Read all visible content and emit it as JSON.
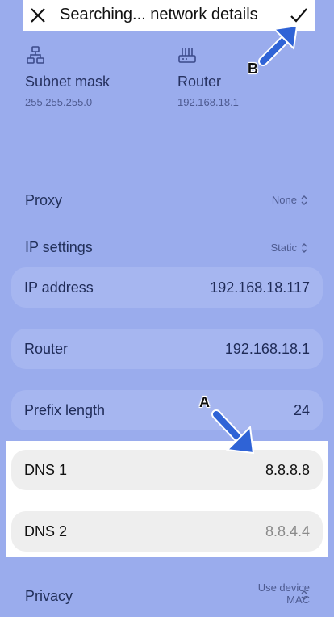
{
  "header": {
    "title": "Searching... network details",
    "close_icon": "close-icon",
    "confirm_icon": "check-icon"
  },
  "info": {
    "subnet": {
      "label": "Subnet mask",
      "value": "255.255.255.0",
      "icon": "network-topology-icon"
    },
    "router": {
      "label": "Router",
      "value": "192.168.18.1",
      "icon": "router-icon"
    }
  },
  "proxy": {
    "label": "Proxy",
    "value": "None"
  },
  "ip_settings": {
    "label": "IP settings",
    "value": "Static"
  },
  "fields": {
    "ip_address": {
      "label": "IP address",
      "value": "192.168.18.117"
    },
    "router": {
      "label": "Router",
      "value": "192.168.18.1"
    },
    "prefix_length": {
      "label": "Prefix length",
      "value": "24"
    },
    "dns1": {
      "label": "DNS 1",
      "value": "8.8.8.8"
    },
    "dns2": {
      "label": "DNS 2",
      "value": "8.8.4.4"
    }
  },
  "privacy": {
    "label": "Privacy",
    "value_line1": "Use device",
    "value_line2": "MAC"
  },
  "annotations": {
    "a": "A",
    "b": "B",
    "arrow_color": "#2f63d6"
  },
  "colors": {
    "background": "#9aaced",
    "card": "#a6b6f0",
    "highlight": "#ffffff"
  }
}
